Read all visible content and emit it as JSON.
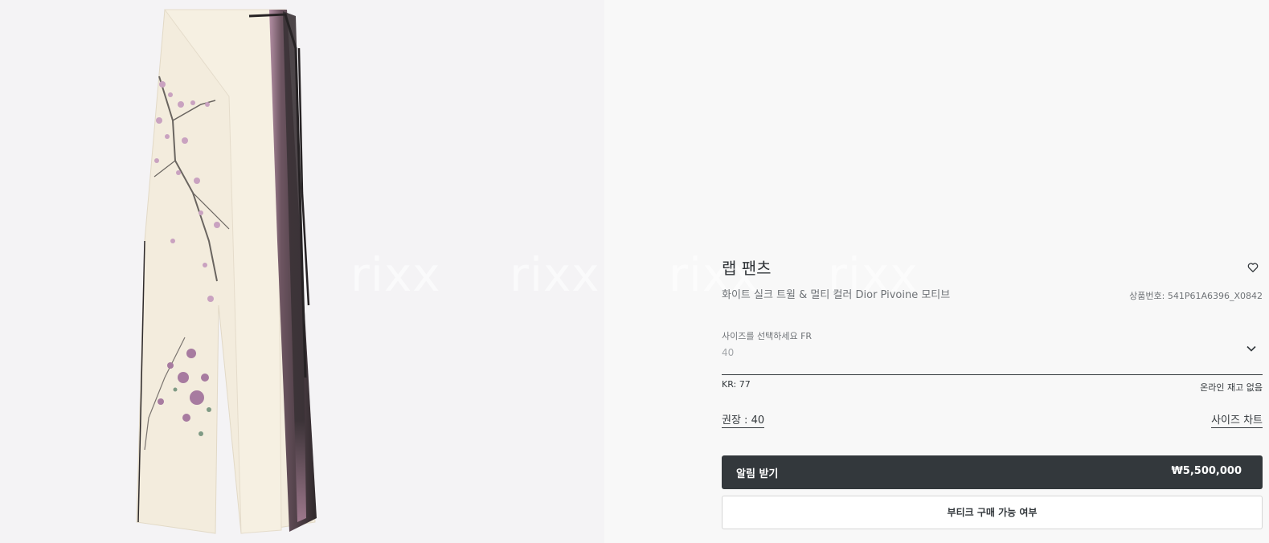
{
  "product": {
    "title": "랩 팬츠",
    "subtitle": "화이트 실크 트윌 & 멀티 컬러 Dior Pivoine 모티브",
    "sku": "상품번호: 541P61A6396_X0842",
    "image_alt": "pants-product-image"
  },
  "watermark": {
    "text": "rixx"
  },
  "size_selector": {
    "label": "사이즈를 선택하세요 FR",
    "value": "40",
    "kr_size": "KR: 77",
    "stock_status": "온라인 재고 없음",
    "recommended": "권장 : 40",
    "size_chart_link": "사이즈 차트"
  },
  "actions": {
    "notify_label": "알림 받기",
    "price": "₩5,500,000",
    "boutique_label": "부티크 구매 가능 여부"
  },
  "colors": {
    "primary_button": "#33383c",
    "background": "#f8f8f8",
    "image_background": "#f4f3f5",
    "fabric": "#f3ecdd",
    "stripe": "#3c3438"
  },
  "icons": {
    "wishlist": "heart-icon",
    "dropdown": "chevron-down-icon"
  }
}
